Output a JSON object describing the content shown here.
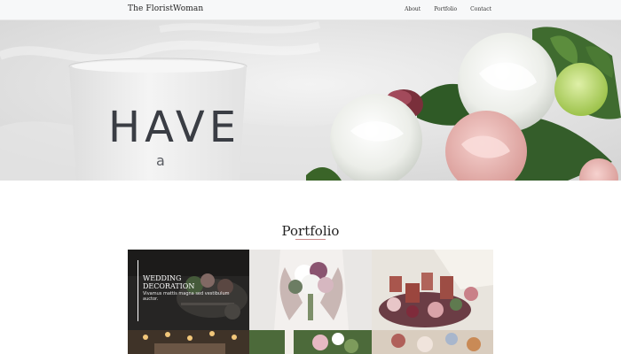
{
  "header": {
    "brand": "The FloristWoman",
    "nav": [
      {
        "label": "About"
      },
      {
        "label": "Portfolio"
      },
      {
        "label": "Contact"
      }
    ]
  },
  "hero": {
    "candle_text_main": "HAVE",
    "candle_text_sub": "a"
  },
  "portfolio": {
    "title": "Portfolio",
    "tiles": [
      {
        "title": "WEDDING DECORATION",
        "description": "Vivamus mattis magna sed vestibulum auctor."
      }
    ]
  },
  "colors": {
    "nav_bg": "#f7f8f9",
    "accent_underline": "#c98a8a"
  }
}
